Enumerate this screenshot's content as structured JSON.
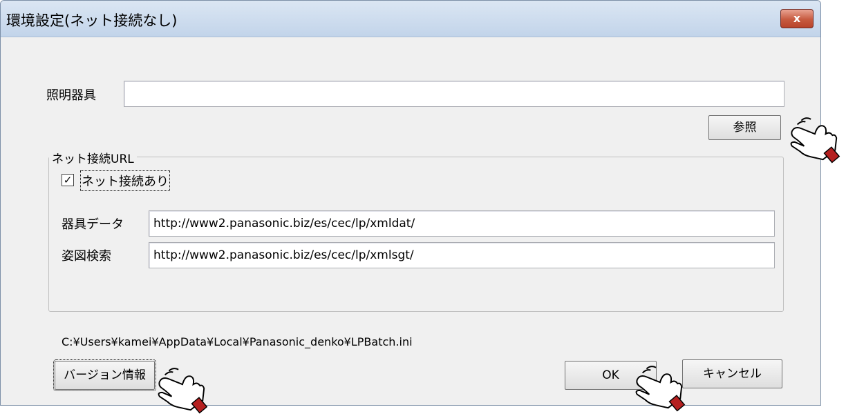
{
  "window": {
    "title": "環境設定(ネット接続なし)",
    "close_label": "x"
  },
  "fixture": {
    "label": "照明器具",
    "value": "",
    "browse_label": "参照"
  },
  "net_group": {
    "legend": "ネット接続URL",
    "checkbox_label": "ネット接続あり",
    "checked": true,
    "fixture_data_label": "器具データ",
    "fixture_data_url": "http://www2.panasonic.biz/es/cec/lp/xmldat/",
    "figure_search_label": "姿図検索",
    "figure_search_url": "http://www2.panasonic.biz/es/cec/lp/xmlsgt/"
  },
  "ini_path": "C:¥Users¥kamei¥AppData¥Local¥Panasonic_denko¥LPBatch.ini",
  "footer": {
    "version_label": "バージョン情報",
    "ok_label": "OK",
    "cancel_label": "キャンセル"
  },
  "icons": {
    "cursor": "hand-pointer-icon"
  }
}
